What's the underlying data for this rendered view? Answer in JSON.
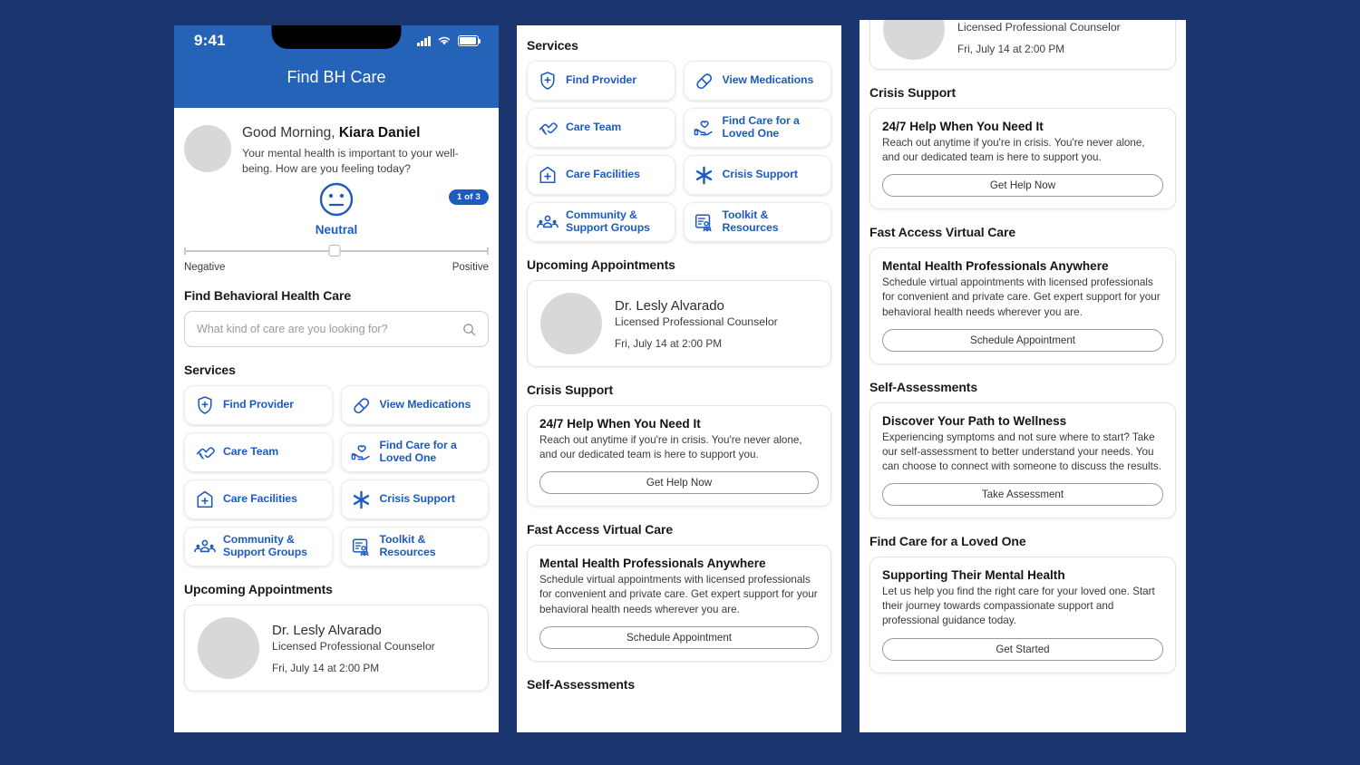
{
  "theme": {
    "page_bg": "#1b356e",
    "header_blue": "#2563b8",
    "accent_blue": "#1d5bbf",
    "badge_blue": "#1d5bbf"
  },
  "status_bar": {
    "time": "9:41",
    "icons": [
      "signal-bars",
      "wifi",
      "battery"
    ]
  },
  "header": {
    "title": "Find BH Care"
  },
  "greeting": {
    "hello_prefix": "Good Morning, ",
    "user_name": "Kiara Daniel",
    "subtitle": "Your mental health is important to your well-being. How are you feeling today?"
  },
  "mood": {
    "badge": "1 of 3",
    "label": "Neutral",
    "icon": "neutral-face-icon",
    "slider_value_percent": 49.5,
    "left_label": "Negative",
    "right_label": "Positive"
  },
  "find_care": {
    "heading": "Find Behavioral Health Care",
    "search_placeholder": "What kind of care are you looking for?",
    "search_value": "",
    "search_icon": "search-icon"
  },
  "services": {
    "heading": "Services",
    "items": [
      {
        "label": "Find Provider",
        "icon": "shield-plus-icon"
      },
      {
        "label": "View Medications",
        "icon": "pill-capsule-icon"
      },
      {
        "label": "Care Team",
        "icon": "handshake-icon"
      },
      {
        "label": "Find Care for a Loved One",
        "icon": "hand-heart-icon"
      },
      {
        "label": "Care Facilities",
        "icon": "hospital-plus-icon"
      },
      {
        "label": "Crisis Support",
        "icon": "asterisk-icon"
      },
      {
        "label": "Community & Support Groups",
        "icon": "people-group-icon"
      },
      {
        "label": "Toolkit & Resources",
        "icon": "clipboard-icon"
      }
    ]
  },
  "appointments": {
    "heading": "Upcoming Appointments",
    "items": [
      {
        "name": "Dr. Lesly Alvarado",
        "role": "Licensed Professional Counselor",
        "datetime": "Fri, July 14 at 2:00 PM",
        "avatar": "provider-avatar"
      }
    ]
  },
  "crisis_support": {
    "heading": "Crisis Support",
    "card_title": "24/7 Help When You Need It",
    "card_body": "Reach out anytime if you're in crisis. You're never alone, and our dedicated team is here to support you.",
    "button": "Get Help Now"
  },
  "virtual_care": {
    "heading": "Fast Access Virtual Care",
    "card_title": "Mental Health Professionals Anywhere",
    "card_body": "Schedule virtual appointments with licensed professionals for convenient and private care. Get expert support for your behavioral health needs wherever you are.",
    "button": "Schedule Appointment"
  },
  "self_assessments": {
    "heading": "Self-Assessments",
    "card_title": "Discover Your Path to Wellness",
    "card_body": "Experiencing symptoms and not sure where to start? Take our self-assessment to better understand your needs. You can choose to connect with someone to discuss the results.",
    "button": "Take Assessment"
  },
  "loved_one": {
    "heading": "Find Care for a Loved One",
    "card_title": "Supporting Their Mental Health",
    "card_body": "Let us help you find the right care for your loved one. Start their journey towards compassionate support and professional guidance today.",
    "button": "Get Started"
  }
}
